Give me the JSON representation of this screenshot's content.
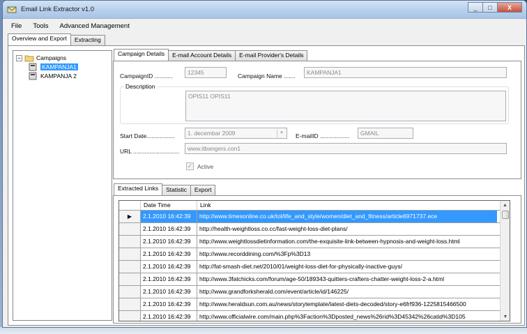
{
  "window": {
    "title": "Email Link Extractor v1.0",
    "min": "_",
    "max": "□",
    "close": "X"
  },
  "menu": [
    "File",
    "Tools",
    "Advanced Management"
  ],
  "outer_tabs": [
    "Overview and Export",
    "Extracting"
  ],
  "tree": {
    "root": "Campaigns",
    "items": [
      "KAMPANJA1",
      "KAMPANJA 2"
    ]
  },
  "detail_tabs": [
    "Campaign Details",
    "E-mail Account Details",
    "E-mail Provider's Details"
  ],
  "details": {
    "campaign_id_label": "CampaignID ...........",
    "campaign_id_value": "12345",
    "campaign_name_label": "Campaign Name .......",
    "campaign_name_value": "KAMPANJA1",
    "description_label": "Description",
    "description_value": "OPIS11 OPIS11",
    "start_date_label": "Start Date.................",
    "start_date_value": "1. decembar 2009",
    "email_id_label": "E-mailID ..................",
    "email_id_value": "GMAIL",
    "url_label": "URL ............................",
    "url_value": "www.itbangers.con1",
    "active_label": "Active",
    "checkmark": "✓"
  },
  "bottom_tabs": [
    "Extracted Links",
    "Statistic",
    "Export"
  ],
  "grid": {
    "columns": [
      "Date Time",
      "Link"
    ],
    "current_row_marker": "▶",
    "rows": [
      {
        "date": "2.1.2010 16:42:39",
        "link": "http://www.timesonline.co.uk/tol/life_and_style/women/diet_and_fitness/article6971737.ece"
      },
      {
        "date": "2.1.2010 16:42:39",
        "link": "http://health-weightloss.co.cc/fast-weight-loss-diet-plans/"
      },
      {
        "date": "2.1.2010 16:42:39",
        "link": "http://www.weightlossdietinformation.com/the-exquisite-link-between-hypnosis-and-weight-loss.html"
      },
      {
        "date": "2.1.2010 16:42:39",
        "link": "http://www.recorddining.com/%3Fp%3D13"
      },
      {
        "date": "2.1.2010 16:42:39",
        "link": "http://fat-smash-diet.net/2010/01/weight-loss-diet-for-physically-inactive-guys/"
      },
      {
        "date": "2.1.2010 16:42:39",
        "link": "http://www.3fatchicks.com/forum/age-50/189343-quitters-crafters-chatter-weight-loss-2-a.html"
      },
      {
        "date": "2.1.2010 16:42:39",
        "link": "http://www.grandforksherald.com/event/article/id/146225/"
      },
      {
        "date": "2.1.2010 16:42:39",
        "link": "http://www.heraldsun.com.au/news/storytemplate/latest-diets-decoded/story-e6frf936-1225815466500"
      },
      {
        "date": "2.1.2010 16:42:39",
        "link": "http://www.officialwire.com/main.php%3Faction%3Dposted_news%26rid%3D45342%26catid%3D105"
      }
    ]
  },
  "scroll": {
    "up": "▲",
    "down": "▼"
  },
  "colors": {
    "selection": "#3399ff",
    "titlebar": "#b9d1ec"
  },
  "icons": [
    "app-icon",
    "folder-icon",
    "campaign-icon",
    "dropdown-arrow-icon"
  ]
}
